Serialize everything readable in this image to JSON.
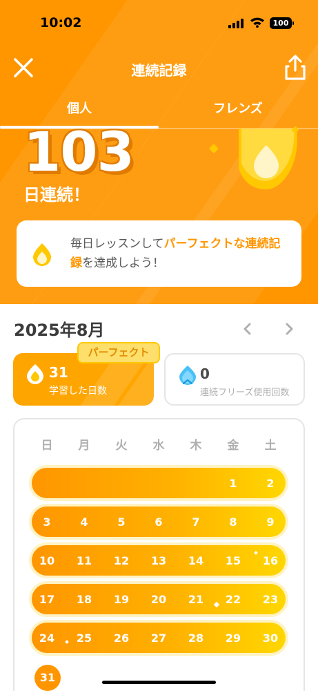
{
  "status_bar": {
    "time": "10:02",
    "battery": "100"
  },
  "nav": {
    "title": "連続記録",
    "close_icon": "close-icon",
    "share_icon": "share-icon"
  },
  "tabs": [
    {
      "label": "個人",
      "selected": true
    },
    {
      "label": "フレンズ",
      "selected": false
    }
  ],
  "streak": {
    "count": "103",
    "label": "日連続！"
  },
  "info_card": {
    "prefix": "毎日レッスンして",
    "highlight": "パーフェクトな連続記録",
    "suffix": "を達成しよう！"
  },
  "month": {
    "title": "2025年8月",
    "prev_icon": "chevron-left-icon",
    "next_icon": "chevron-right-icon"
  },
  "stats": {
    "badge": "パーフェクト",
    "study_days": {
      "value": "31",
      "label": "学習した日数"
    },
    "freeze": {
      "value": "0",
      "label": "連続フリーズ使用回数"
    }
  },
  "calendar": {
    "weekdays": [
      "日",
      "月",
      "火",
      "水",
      "木",
      "金",
      "土"
    ],
    "weeks": [
      [
        "",
        "",
        "",
        "",
        "",
        "1",
        "2"
      ],
      [
        "3",
        "4",
        "5",
        "6",
        "7",
        "8",
        "9"
      ],
      [
        "10",
        "11",
        "12",
        "13",
        "14",
        "15",
        "16"
      ],
      [
        "17",
        "18",
        "19",
        "20",
        "21",
        "22",
        "23"
      ],
      [
        "24",
        "25",
        "26",
        "27",
        "28",
        "29",
        "30"
      ],
      [
        "31"
      ]
    ]
  },
  "colors": {
    "primary": "#ff9600",
    "accent": "#ffc800",
    "text": "#3c3c3c",
    "muted": "#afafaf",
    "freeze": "#49c0f8"
  }
}
